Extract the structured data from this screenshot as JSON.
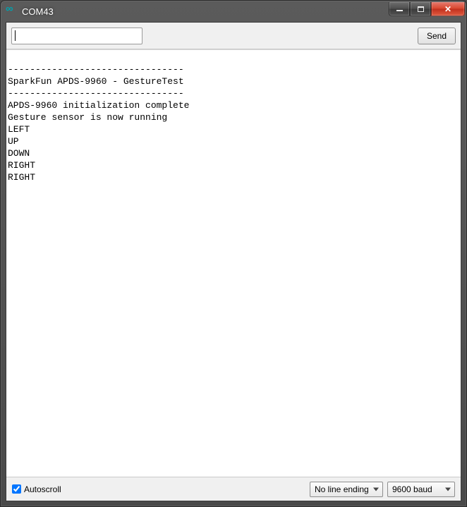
{
  "window": {
    "title": "COM43"
  },
  "toolbar": {
    "input_value": "",
    "input_placeholder": "",
    "send_label": "Send"
  },
  "console": {
    "lines": [
      "",
      "--------------------------------",
      "SparkFun APDS-9960 - GestureTest",
      "--------------------------------",
      "APDS-9960 initialization complete",
      "Gesture sensor is now running",
      "LEFT",
      "UP",
      "DOWN",
      "RIGHT",
      "RIGHT"
    ]
  },
  "footer": {
    "autoscroll_label": "Autoscroll",
    "autoscroll_checked": true,
    "line_ending_selected": "No line ending",
    "baud_selected": "9600 baud"
  }
}
